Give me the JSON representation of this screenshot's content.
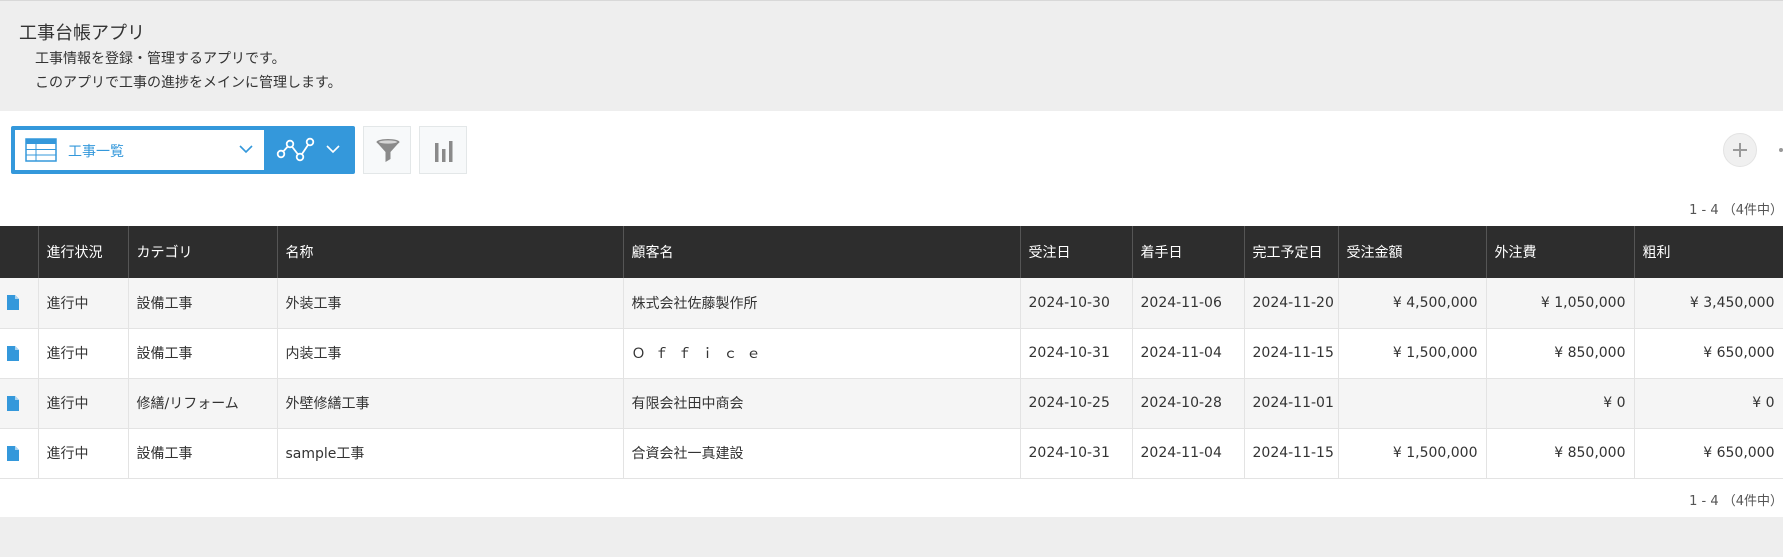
{
  "app": {
    "title": "工事台帳アプリ",
    "description_line1": "工事情報を登録・管理するアプリです。",
    "description_line2": "このアプリで工事の進捗をメインに管理します。"
  },
  "toolbar": {
    "view_label": "工事一覧",
    "view_icon": "table-grid-icon",
    "graph_icon": "line-graph-icon",
    "filter_icon": "funnel-icon",
    "chart_icon": "bar-chart-icon",
    "add_icon": "plus-icon"
  },
  "pagination": {
    "top": "1 - 4 （4件中）",
    "bottom": "1 - 4 （4件中）"
  },
  "table": {
    "headers": [
      "進行状況",
      "カテゴリ",
      "名称",
      "顧客名",
      "受注日",
      "着手日",
      "完工予定日",
      "受注金額",
      "外注費",
      "粗利"
    ],
    "rows": [
      {
        "status": "進行中",
        "category": "設備工事",
        "name": "外装工事",
        "customer": "株式会社佐藤製作所",
        "order_date": "2024-10-30",
        "start_date": "2024-11-06",
        "completion_date": "2024-11-20",
        "order_amount": "¥ 4,500,000",
        "outsource_cost": "¥ 1,050,000",
        "gross_profit": "¥ 3,450,000"
      },
      {
        "status": "進行中",
        "category": "設備工事",
        "name": "内装工事",
        "customer": "Ｏｆｆｉｃｅ",
        "order_date": "2024-10-31",
        "start_date": "2024-11-04",
        "completion_date": "2024-11-15",
        "order_amount": "¥ 1,500,000",
        "outsource_cost": "¥ 850,000",
        "gross_profit": "¥ 650,000"
      },
      {
        "status": "進行中",
        "category": "修繕/リフォーム",
        "name": "外壁修繕工事",
        "customer": "有限会社田中商会",
        "order_date": "2024-10-25",
        "start_date": "2024-10-28",
        "completion_date": "2024-11-01",
        "order_amount": "",
        "outsource_cost": "¥ 0",
        "gross_profit": "¥ 0"
      },
      {
        "status": "進行中",
        "category": "設備工事",
        "name": "sample工事",
        "customer": "合資会社一真建設",
        "order_date": "2024-10-31",
        "start_date": "2024-11-04",
        "completion_date": "2024-11-15",
        "order_amount": "¥ 1,500,000",
        "outsource_cost": "¥ 850,000",
        "gross_profit": "¥ 650,000"
      }
    ]
  },
  "colors": {
    "accent": "#3498db",
    "header_bg": "#2d2d2d",
    "page_bg": "#eeeeee"
  }
}
